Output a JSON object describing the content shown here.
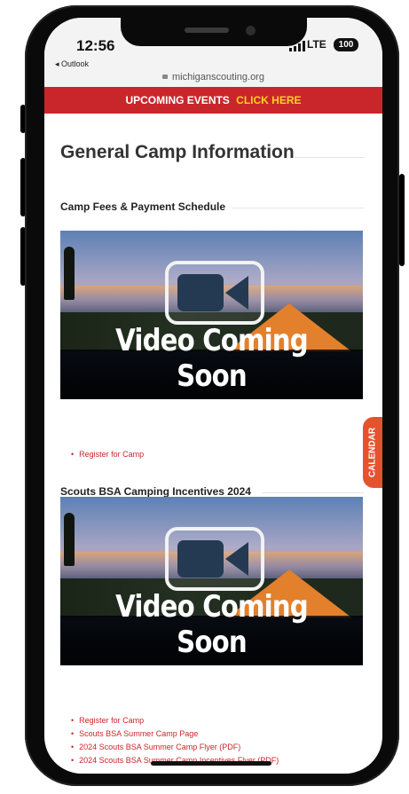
{
  "status_bar": {
    "time": "12:56",
    "back_app": "Outlook",
    "network": "LTE",
    "battery": "100"
  },
  "browser": {
    "url": "michiganscouting.org"
  },
  "banner": {
    "text": "UPCOMING EVENTS",
    "cta": "CLICK HERE"
  },
  "page": {
    "title": "General Camp Information"
  },
  "sections": [
    {
      "heading": "Camp Fees & Payment Schedule",
      "video_caption": "Video Coming Soon",
      "links": [
        "Register for Camp"
      ]
    },
    {
      "heading": "Scouts BSA Camping Incentives 2024",
      "video_caption": "Video Coming Soon",
      "links": [
        "Register for Camp",
        "Scouts BSA Summer Camp Page",
        "2024 Scouts BSA Summer Camp Flyer (PDF)",
        "2024 Scouts BSA Summer Camp Incentives Flyer (PDF)"
      ]
    }
  ],
  "calendar_tab": "CALENDAR",
  "colors": {
    "banner_red": "#c9262b",
    "banner_cta": "#ffcf24",
    "link_red": "#c9262b",
    "calendar_orange": "#e5532e"
  },
  "icons": [
    "lock-icon",
    "video-camera-icon",
    "signal-icon",
    "battery-icon"
  ]
}
